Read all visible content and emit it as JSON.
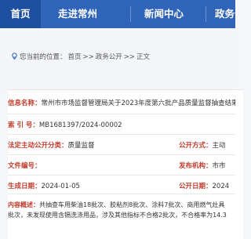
{
  "nav": {
    "items": [
      "首页",
      "走进常州",
      "新闻中心",
      "政务公"
    ]
  },
  "breadcrumb": {
    "prefix": "您当前的位置：",
    "items": [
      "首页",
      "政务公开",
      "正文"
    ],
    "sep": ">>"
  },
  "info": {
    "title_label": "信息名称：",
    "title_value": "常州市市场监督管理局关于2023年度第六批产品质量监督抽查结果",
    "index_label": "索  引  号：",
    "index_value": "MB1681397/2024-00002",
    "subject_label": "法定主动公开分类：",
    "subject_value": "质量监督",
    "public_label": "公开方式：",
    "public_value": "主动",
    "docno_label": "文件编号：",
    "docno_value": "",
    "publisher_label": "发布机构：",
    "publisher_value": "市市",
    "created_label": "生成日期：",
    "created_value": "2024-01-05",
    "pubdate_label": "公开日期：",
    "pubdate_value": "2024",
    "summary_label": "内容概述：",
    "summary_line1": "共抽查车用柴油18批次、胶粘剂8批次、涂料7批次、商用燃气灶具",
    "summary_line2": "批次，未发现使用含镉洗涤用品，涉及其他指标不合格2批次，不合格率为14.3"
  },
  "colors": {
    "nav_bg": "#2f64b8",
    "nav_active": "#1d4f9e",
    "label_red": "#c13a2a"
  }
}
